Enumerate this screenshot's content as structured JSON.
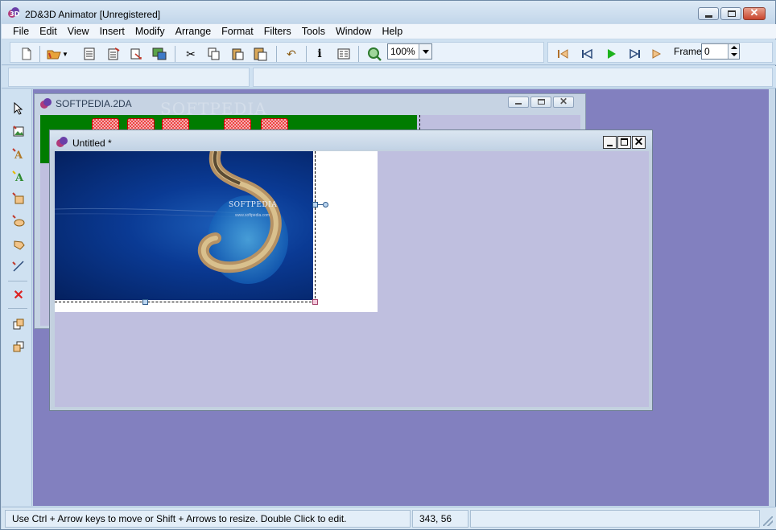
{
  "window": {
    "title": "2D&3D Animator [Unregistered]"
  },
  "menu": [
    "File",
    "Edit",
    "View",
    "Insert",
    "Modify",
    "Arrange",
    "Format",
    "Filters",
    "Tools",
    "Window",
    "Help"
  ],
  "toolbar": {
    "zoom_value": "100%",
    "frame_label": "Frame:",
    "frame_value": "0"
  },
  "documents": {
    "back": {
      "title": "SOFTPEDIA.2DA",
      "watermark": "SOFTPEDIA"
    },
    "front": {
      "title": "Untitled *"
    }
  },
  "image": {
    "brand_text": "SOFTPEDIA",
    "url_text": "www.softpedia.com"
  },
  "status": {
    "hint": "Use Ctrl + Arrow keys to move or Shift + Arrows to resize. Double Click to edit.",
    "coords": "343, 56",
    "extra": ""
  },
  "colors": {
    "mdi_background": "#8280bf",
    "canvas_background": "#bfbfdf",
    "timeline_green": "#007c00",
    "chrome": "#cfe1f1"
  }
}
